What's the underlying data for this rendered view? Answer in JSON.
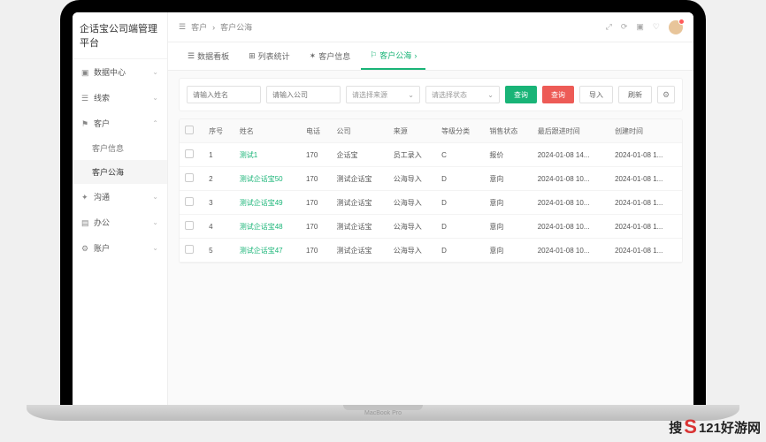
{
  "app_title": "企话宝公司端管理平台",
  "sidebar": {
    "items": [
      {
        "icon": "▣",
        "label": "数据中心"
      },
      {
        "icon": "☰",
        "label": "线索"
      },
      {
        "icon": "⚑",
        "label": "客户"
      },
      {
        "icon": "✦",
        "label": "沟通"
      },
      {
        "icon": "▤",
        "label": "办公"
      },
      {
        "icon": "⚙",
        "label": "账户"
      }
    ],
    "subs": [
      {
        "label": "客户信息"
      },
      {
        "label": "客户公海"
      }
    ]
  },
  "breadcrumb": {
    "icon": "☰",
    "root": "客户",
    "sep": "›",
    "current": "客户公海"
  },
  "topbar_icons": {
    "a": "⤢",
    "b": "⟳",
    "c": "▣",
    "d": "♡"
  },
  "tabs": [
    {
      "icon": "☰",
      "label": "数据看板"
    },
    {
      "icon": "⊞",
      "label": "列表统计"
    },
    {
      "icon": "✶",
      "label": "客户信息"
    },
    {
      "icon": "⚐",
      "label": "客户公海",
      "sep": "›"
    }
  ],
  "filters": {
    "name_ph": "请输入姓名",
    "company_ph": "请输入公司",
    "source_ph": "请选择来源",
    "status_ph": "请选择状态",
    "buttons": {
      "search": "查询",
      "delete": "查询",
      "import": "导入",
      "refresh": "刷新",
      "settings": "⚙"
    },
    "chev": "⌄"
  },
  "table": {
    "headers": [
      "",
      "序号",
      "姓名",
      "电话",
      "公司",
      "来源",
      "等级分类",
      "销售状态",
      "最后跟进时间",
      "创建时间"
    ],
    "rows": [
      {
        "num": "1",
        "name": "测试1",
        "phone": "170",
        "company": "企话宝",
        "source": "员工录入",
        "level": "C",
        "status": "报价",
        "last": "2024-01-08 14...",
        "created": "2024-01-08 1..."
      },
      {
        "num": "2",
        "name": "测试企话宝50",
        "phone": "170",
        "company": "测试企话宝",
        "source": "公海导入",
        "level": "D",
        "status": "意向",
        "last": "2024-01-08 10...",
        "created": "2024-01-08 1..."
      },
      {
        "num": "3",
        "name": "测试企话宝49",
        "phone": "170",
        "company": "测试企话宝",
        "source": "公海导入",
        "level": "D",
        "status": "意向",
        "last": "2024-01-08 10...",
        "created": "2024-01-08 1..."
      },
      {
        "num": "4",
        "name": "测试企话宝48",
        "phone": "170",
        "company": "测试企话宝",
        "source": "公海导入",
        "level": "D",
        "status": "意向",
        "last": "2024-01-08 10...",
        "created": "2024-01-08 1..."
      },
      {
        "num": "5",
        "name": "测试企话宝47",
        "phone": "170",
        "company": "测试企话宝",
        "source": "公海导入",
        "level": "D",
        "status": "意向",
        "last": "2024-01-08 10...",
        "created": "2024-01-08 1..."
      }
    ]
  },
  "laptop_base": "MacBook Pro",
  "watermark": {
    "pre": "搜",
    "logo": "S",
    "post": "121好游网"
  }
}
